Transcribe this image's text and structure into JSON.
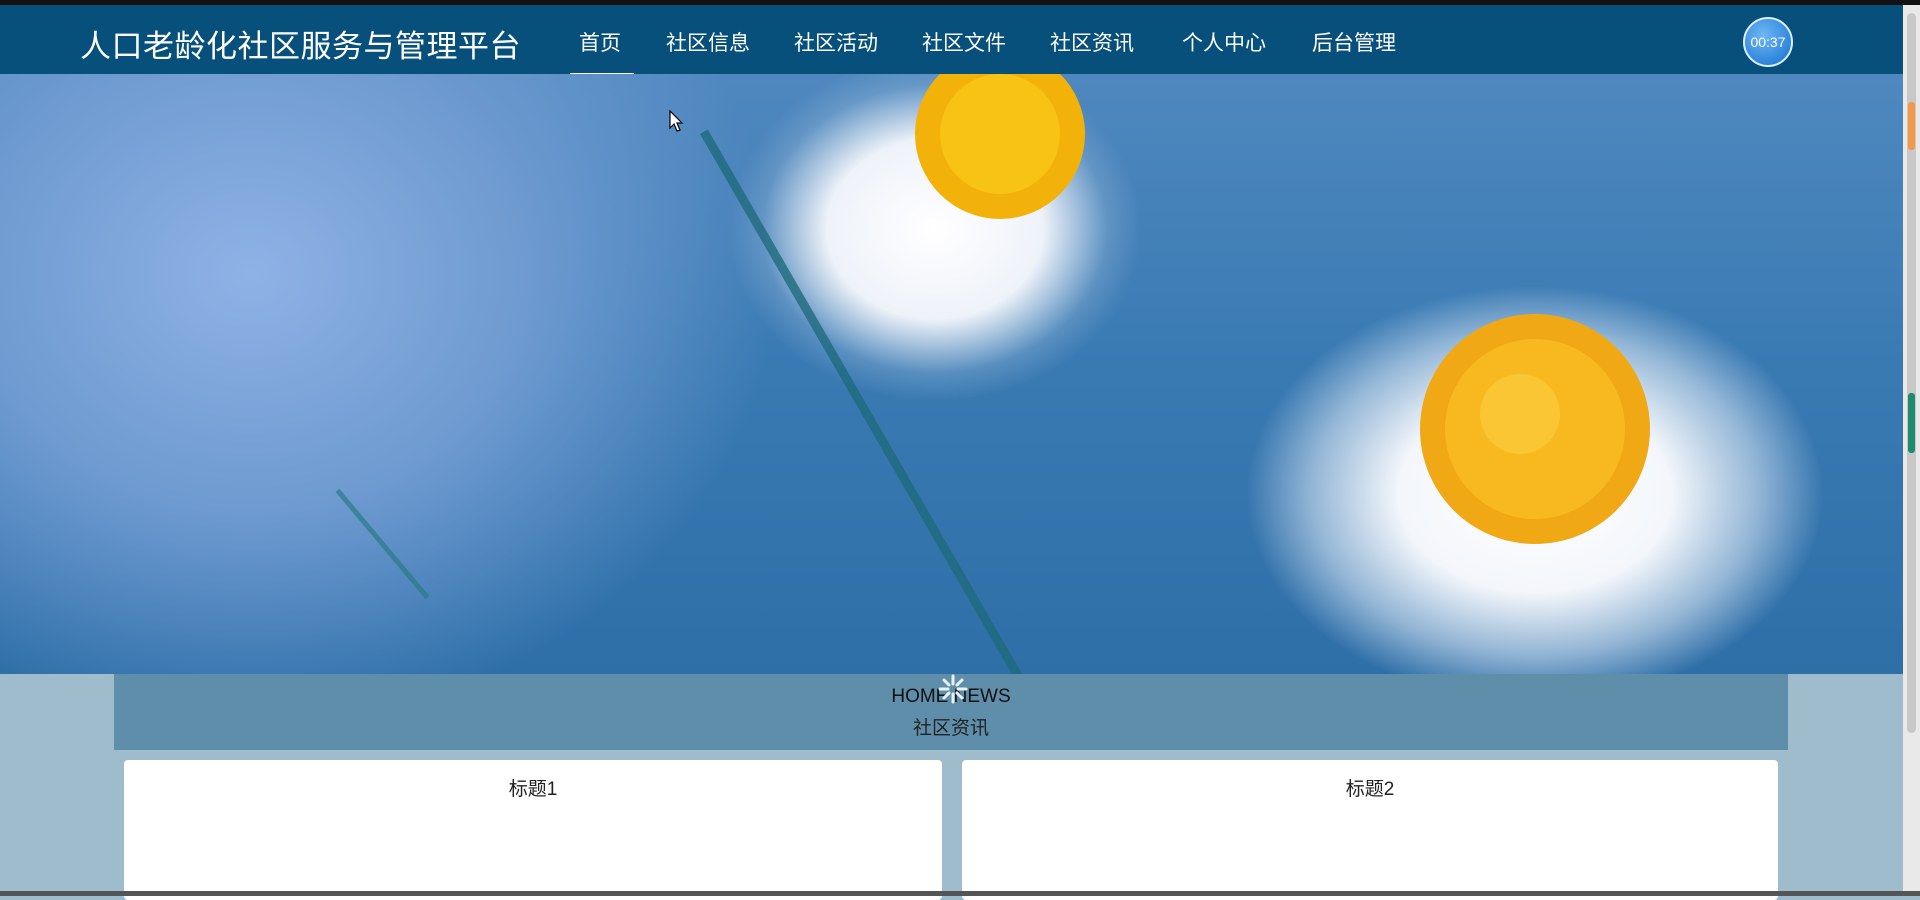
{
  "header": {
    "site_title": "人口老龄化社区服务与管理平台",
    "nav": [
      {
        "label": "首页",
        "active": true
      },
      {
        "label": "社区信息"
      },
      {
        "label": "社区活动"
      },
      {
        "label": "社区文件"
      },
      {
        "label": "社区资讯"
      },
      {
        "label": "个人中心"
      },
      {
        "label": "后台管理"
      }
    ],
    "clock": "00:37"
  },
  "banner": {
    "slide_count": 3
  },
  "news": {
    "heading_en": "HOME NEWS",
    "heading_zh": "社区资讯",
    "cards": [
      {
        "title": "标题1"
      },
      {
        "title": "标题2"
      }
    ]
  },
  "colors": {
    "nav_bg": "#07507b",
    "page_bg": "#9ebccc",
    "news_header_bg": "#5f8eab"
  }
}
